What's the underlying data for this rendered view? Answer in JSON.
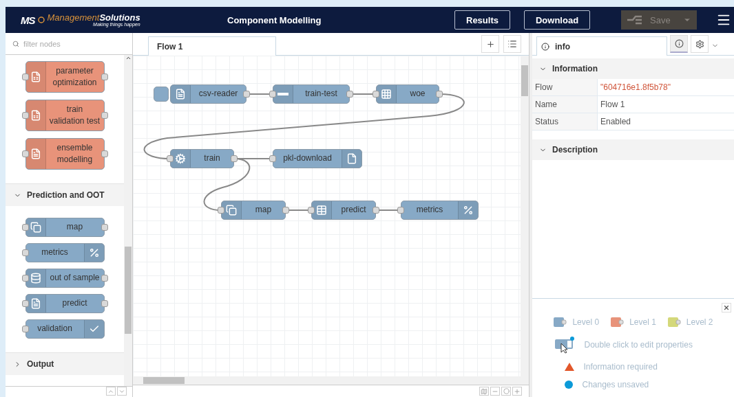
{
  "header": {
    "logo": {
      "mark": "MS",
      "brand_light": "Management",
      "brand_bold": "Solutions",
      "tagline": "Making things happen"
    },
    "title": "Component Modelling",
    "buttons": [
      {
        "label": "Results"
      },
      {
        "label": "Download"
      }
    ],
    "save": {
      "label": "Save",
      "disabled": true
    }
  },
  "palette": {
    "filter_placeholder": "filter nodes",
    "top_nodes": [
      {
        "label": "parameter\noptimization",
        "color": "#e8937a",
        "kind": "icon_left",
        "input": true,
        "output": true
      },
      {
        "label": "train\nvalidation test",
        "color": "#e8937a",
        "kind": "icon_left",
        "input": true,
        "output": true
      },
      {
        "label": "ensemble\nmodelling",
        "color": "#e8937a",
        "kind": "icon_left",
        "input": true,
        "output": true
      }
    ],
    "sections": [
      {
        "title": "Prediction and OOT",
        "expanded": true,
        "nodes": [
          {
            "label": "map",
            "color": "#87a9c6",
            "kind": "icon_left",
            "input": true,
            "output": true
          },
          {
            "label": "metrics",
            "color": "#87a9c6",
            "kind": "icon_right",
            "input": true,
            "output": false
          },
          {
            "label": "out of sample",
            "color": "#87a9c6",
            "kind": "icon_left",
            "input": true,
            "output": true
          },
          {
            "label": "predict",
            "color": "#87a9c6",
            "kind": "icon_left",
            "input": true,
            "output": true
          },
          {
            "label": "validation",
            "color": "#87a9c6",
            "kind": "icon_right",
            "input": true,
            "output": false
          }
        ]
      },
      {
        "title": "Output",
        "expanded": false
      }
    ]
  },
  "workspace": {
    "tabs": [
      {
        "label": "Flow 1",
        "selected": true
      }
    ],
    "nodes": [
      {
        "label": "csv-reader",
        "kind": "icon_left",
        "input": false,
        "output": true,
        "inject": true
      },
      {
        "label": "train-test",
        "kind": "icon_left",
        "input": true,
        "output": true
      },
      {
        "label": "woe",
        "kind": "icon_left",
        "input": true,
        "output": true
      },
      {
        "label": "train",
        "kind": "icon_left",
        "input": true,
        "output": true
      },
      {
        "label": "pkl-download",
        "kind": "icon_right",
        "input": true,
        "output": false
      },
      {
        "label": "map",
        "kind": "icon_left",
        "input": true,
        "output": true
      },
      {
        "label": "predict",
        "kind": "icon_left",
        "input": true,
        "output": true
      },
      {
        "label": "metrics",
        "kind": "icon_right",
        "input": true,
        "output": false
      }
    ]
  },
  "sidebar": {
    "tab_label": "info",
    "tab_buttons": [
      {
        "selected": true
      },
      {
        "selected": false
      }
    ],
    "sections": [
      {
        "title": "Information",
        "expanded": true
      },
      {
        "title": "Description",
        "expanded": true
      }
    ],
    "info_rows": [
      {
        "key": "Flow",
        "value": "\"604716e1.8f5b78\"",
        "kind": "id"
      },
      {
        "key": "Name",
        "value": "Flow 1",
        "kind": "text"
      },
      {
        "key": "Status",
        "value": "Enabled",
        "kind": "text"
      }
    ],
    "legend": {
      "levels": [
        {
          "label": "Level 0",
          "color": "#87a9c6"
        },
        {
          "label": "Level 1",
          "color": "#e8937a"
        },
        {
          "label": "Level 2",
          "color": "#d4d87a"
        }
      ],
      "hints": [
        {
          "kind": "node",
          "text": "Double click to edit properties"
        },
        {
          "kind": "triangle",
          "text": "Information required"
        },
        {
          "kind": "dot",
          "text": "Changes unsaved"
        }
      ]
    }
  }
}
